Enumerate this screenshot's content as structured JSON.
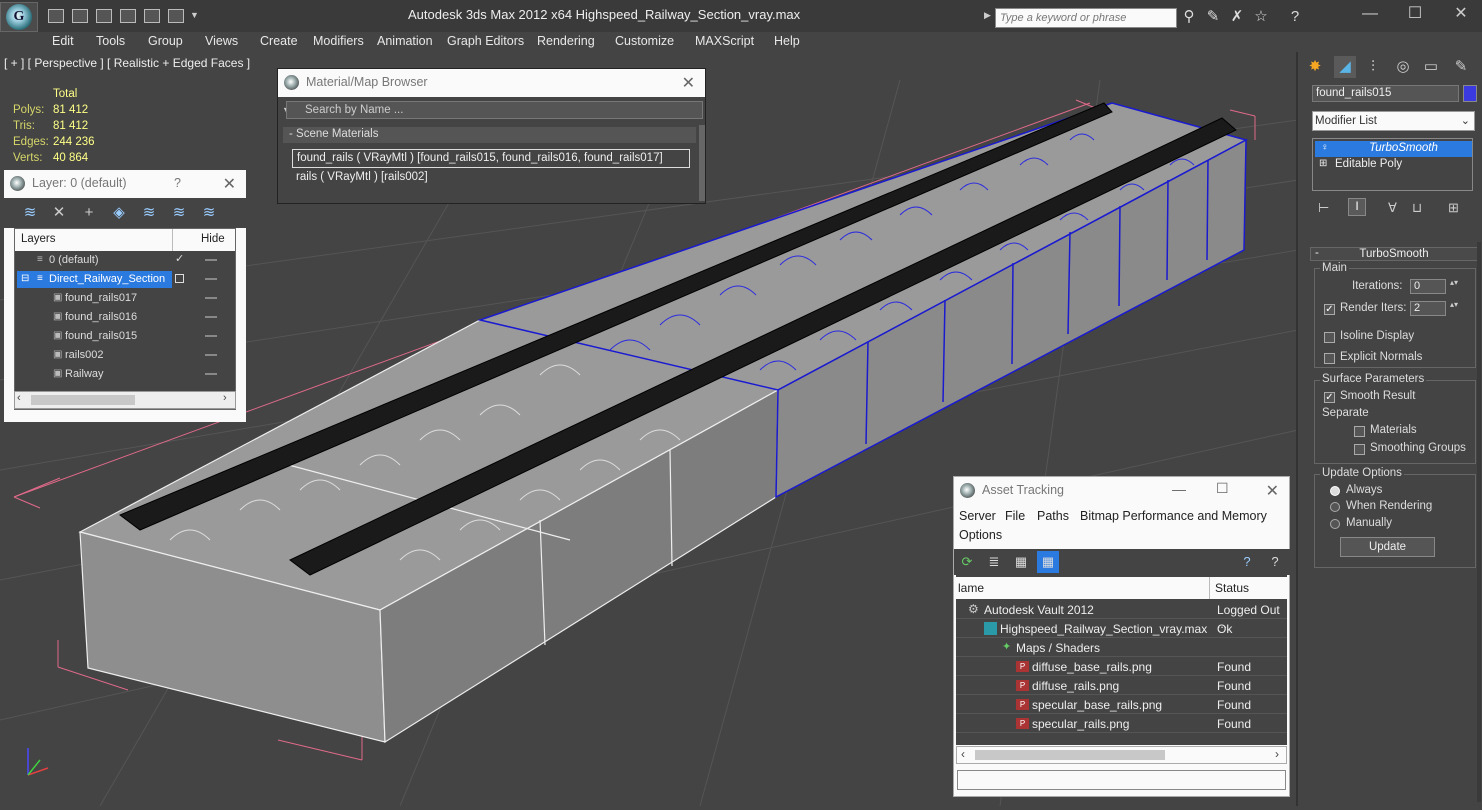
{
  "app": {
    "title": "Autodesk 3ds Max  2012 x64      Highspeed_Railway_Section_vray.max",
    "search_placeholder": "Type a keyword or phrase",
    "menu": [
      "Edit",
      "Tools",
      "Group",
      "Views",
      "Create",
      "Modifiers",
      "Animation",
      "Graph Editors",
      "Rendering",
      "Customize",
      "MAXScript",
      "Help"
    ]
  },
  "viewport": {
    "label": "[ + ] [ Perspective ] [ Realistic + Edged Faces ]",
    "stats": {
      "header": "Total",
      "polys_label": "Polys:",
      "polys": "81 412",
      "tris_label": "Tris:",
      "tris": "81 412",
      "edges_label": "Edges:",
      "edges": "244 236",
      "verts_label": "Verts:",
      "verts": "40 864"
    }
  },
  "layer_panel": {
    "title": "Layer: 0 (default)",
    "help": "?",
    "col_layers": "Layers",
    "col_hide": "Hide",
    "rows": [
      {
        "name": "0 (default)"
      },
      {
        "name": "Direct_Railway_Section"
      },
      {
        "name": "found_rails017"
      },
      {
        "name": "found_rails016"
      },
      {
        "name": "found_rails015"
      },
      {
        "name": "rails002"
      },
      {
        "name": "Railway"
      }
    ]
  },
  "material_browser": {
    "title": "Material/Map Browser",
    "search_placeholder": "Search by Name ...",
    "section": "- Scene Materials",
    "items": [
      "found_rails  ( VRayMtl ) [found_rails015, found_rails016, found_rails017]",
      "rails  ( VRayMtl ) [rails002]"
    ]
  },
  "command_panel": {
    "object_name": "found_rails015",
    "object_color": "#3a3ae0",
    "modifier_list": "Modifier List",
    "stack": [
      "TurboSmooth",
      "Editable Poly"
    ],
    "rollout_title": "TurboSmooth",
    "main": "Main",
    "iterations_label": "Iterations:",
    "iterations": "0",
    "render_iters_label": "Render Iters:",
    "render_iters": "2",
    "isoline": "Isoline Display",
    "explicit_normals": "Explicit Normals",
    "surface_params": "Surface Parameters",
    "smooth_result": "Smooth Result",
    "separate": "Separate",
    "materials": "Materials",
    "smoothing_groups": "Smoothing Groups",
    "update_options": "Update Options",
    "always": "Always",
    "when_rendering": "When Rendering",
    "manually": "Manually",
    "update_btn": "Update"
  },
  "asset_tracking": {
    "title": "Asset Tracking",
    "menu": [
      "Server",
      "File",
      "Paths",
      "Bitmap Performance and Memory",
      "Options"
    ],
    "col_name": "lame",
    "col_status": "Status",
    "rows": [
      {
        "name": "Autodesk Vault 2012",
        "status": "Logged Out ..."
      },
      {
        "name": "Highspeed_Railway_Section_vray.max",
        "status": "Ok"
      },
      {
        "name": "Maps / Shaders",
        "status": ""
      },
      {
        "name": "diffuse_base_rails.png",
        "status": "Found"
      },
      {
        "name": "diffuse_rails.png",
        "status": "Found"
      },
      {
        "name": "specular_base_rails.png",
        "status": "Found"
      },
      {
        "name": "specular_rails.png",
        "status": "Found"
      }
    ]
  }
}
